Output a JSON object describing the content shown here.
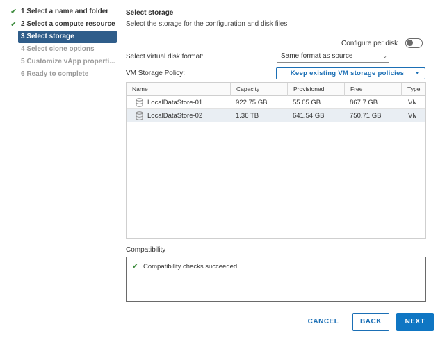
{
  "wizard": {
    "steps": [
      {
        "label": "1 Select a name and folder",
        "state": "done"
      },
      {
        "label": "2 Select a compute resource",
        "state": "done"
      },
      {
        "label": "3 Select storage",
        "state": "active"
      },
      {
        "label": "4 Select clone options",
        "state": "pending"
      },
      {
        "label": "5 Customize vApp properti...",
        "state": "pending"
      },
      {
        "label": "6 Ready to complete",
        "state": "pending"
      }
    ],
    "check_glyph": "✔"
  },
  "page": {
    "title": "Select storage",
    "subtitle": "Select the storage for the configuration and disk files"
  },
  "config": {
    "configure_per_disk_label": "Configure per disk",
    "configure_per_disk_on": false,
    "disk_format_label": "Select virtual disk format:",
    "disk_format_value": "Same format as source",
    "storage_policy_label": "VM Storage Policy:",
    "storage_policy_value": "Keep existing VM storage policies"
  },
  "table": {
    "columns": [
      "Name",
      "Capacity",
      "Provisioned",
      "Free",
      "Type"
    ],
    "rows": [
      {
        "name": "LocalDataStore-01",
        "capacity": "922.75 GB",
        "provisioned": "55.05 GB",
        "free": "867.7 GB",
        "type": "VM",
        "selected": false
      },
      {
        "name": "LocalDataStore-02",
        "capacity": "1.36 TB",
        "provisioned": "641.54 GB",
        "free": "750.71 GB",
        "type": "VM",
        "selected": true
      }
    ]
  },
  "compatibility": {
    "label": "Compatibility",
    "message": "Compatibility checks succeeded.",
    "check_glyph": "✔"
  },
  "footer": {
    "cancel_label": "CANCEL",
    "back_label": "BACK",
    "next_label": "NEXT"
  },
  "colors": {
    "accent": "#1b6fb5",
    "primary_button": "#0f76c3",
    "active_step": "#2f5d8a",
    "success": "#3d8b3d"
  },
  "icons": {
    "datastore": "database-icon",
    "dropdown": "chevron-down-icon",
    "success": "check-icon"
  }
}
